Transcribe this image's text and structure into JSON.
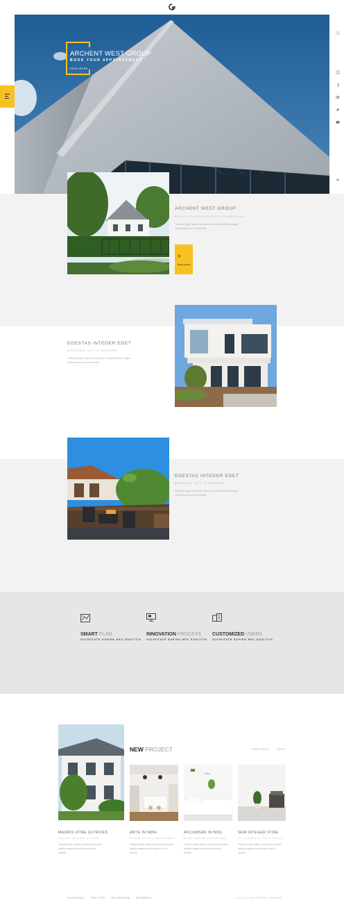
{
  "hero": {
    "title": "ARCHENT WEST GROUP",
    "subtitle": "BOOK YOUR APPOINTEMENT",
    "more_label": "READ MORE"
  },
  "social_icons": [
    "search-icon",
    "dribbble-icon",
    "facebook-icon",
    "google-plus-icon",
    "twitter-icon",
    "youtube-icon"
  ],
  "sections": [
    {
      "title": "ARCHENT WEST GROUP",
      "subtitle": "SOLLICITUDIN AD ODIT PHASELLUS",
      "text": "Tincidunt eget nullam non nisi est sit amet facilisis magna etiam tempor orci eu lobortis.",
      "button_label": "READ MORE"
    },
    {
      "title": "EGESTAS INTEGER EGET",
      "subtitle": "EGESTAS QUI IS DANDRE",
      "text": "Tincidunt eget nullam non nisi est sit amet facilisis magna etiam tempor orci eu lobortis."
    },
    {
      "title": "EGESTAS INTEGER EGET",
      "subtitle": "EGESTAS QUI IS DANDRE",
      "text": "Tincidunt eget nullam non nisi est sit amet facilisis magna etiam tempor orci eu lobortis."
    }
  ],
  "features": [
    {
      "icon": "blueprint-icon",
      "title_bold": "SMART",
      "title_light": "PLAN",
      "subtitle": "VULPUTATE SAPIEN NEC SAGITTIS"
    },
    {
      "icon": "monitor-icon",
      "title_bold": "INNOVATION",
      "title_light": "PROCESS",
      "subtitle": "VULPUTATE SAPIEN NEC SAGITTIS"
    },
    {
      "icon": "building-icon",
      "title_bold": "CUSTOMIZED",
      "title_light": "USERS",
      "subtitle": "VULPUTATE SAPIEN NEC SAGITTIS"
    }
  ],
  "new_project": {
    "title_bold": "NEW",
    "title_light": "PROJECT",
    "prev_label": "PREVIOUS",
    "next_label": "NEXT",
    "cards": [
      {
        "title": "MAURIS VITAE ULTRICES",
        "subtitle": "TELLUS MAURIS A DIAM",
        "text": "Tincidunt eget nullam non nisi est sit amet facilisis magna etiam tempor orci eu lobortis."
      },
      {
        "title": "ANTE IN NIBH",
        "subtitle": "FUSCE UT PLACERAT ORCI",
        "text": "Tincidunt eget nullam non nisi est sit amet facilisis magna etiam tempor orci eu lobortis."
      },
      {
        "title": "ACCUMSAN IN NISL",
        "subtitle": "EGET LOREM DOLOR SED",
        "text": "Tincidunt eget nullam non nisi est sit amet facilisis magna etiam tempor orci eu lobortis."
      },
      {
        "title": "SEM INTEGER VITAE",
        "subtitle": "UT PLACERAT ORCI NULLA",
        "text": "Tincidunt eget nullam non nisi est sit amet facilisis magna etiam tempor orci eu lobortis."
      }
    ]
  },
  "footer": {
    "links": [
      "FACEBOOK",
      "TWITTER",
      "INSTAGRAM",
      "DRIBBBLE"
    ],
    "copyright": "2020 © COPYRIGHT MIKADO"
  },
  "colors": {
    "accent": "#f7c221",
    "light_band": "#f2f2f2",
    "mid_band": "#e6e6e6",
    "sky": "#2e6aa0"
  }
}
